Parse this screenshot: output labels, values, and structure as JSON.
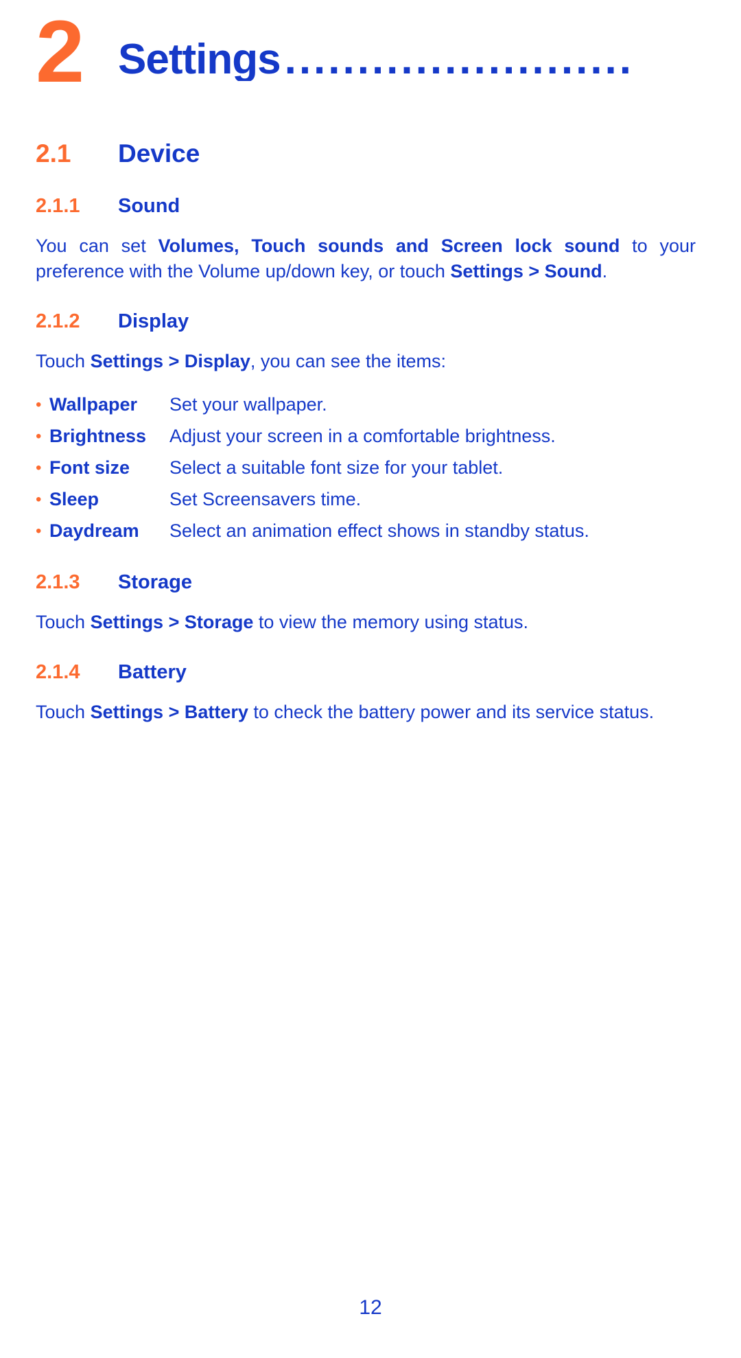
{
  "colors": {
    "accent_orange": "#fc6a2f",
    "accent_blue": "#1539c8",
    "background": "#ffffff"
  },
  "chapter": {
    "number": "2",
    "title": "Settings",
    "dots": "........................"
  },
  "sections": {
    "device": {
      "number": "2.1",
      "title": "Device"
    },
    "sound": {
      "number": "2.1.1",
      "title": "Sound",
      "paragraph": {
        "part1": "You can set ",
        "bold1": "Volumes, Touch sounds and Screen lock sound",
        "part2": " to your preference with the Volume up/down key, or touch ",
        "bold2": "Settings > Sound",
        "part3": "."
      }
    },
    "display": {
      "number": "2.1.2",
      "title": "Display",
      "intro": {
        "part1": "Touch ",
        "bold1": "Settings > Display",
        "part2": ", you can see the items:"
      },
      "items": [
        {
          "bullet": "•",
          "term": "Wallpaper",
          "desc": "Set your wallpaper."
        },
        {
          "bullet": "•",
          "term": "Brightness",
          "desc": "Adjust your screen in a comfortable brightness."
        },
        {
          "bullet": "•",
          "term": "Font size",
          "desc": "Select a suitable font size for your tablet."
        },
        {
          "bullet": "•",
          "term": "Sleep",
          "desc": "Set Screensavers time."
        },
        {
          "bullet": "•",
          "term": "Daydream",
          "desc": "Select an animation effect shows in standby status."
        }
      ]
    },
    "storage": {
      "number": "2.1.3",
      "title": "Storage",
      "paragraph": {
        "part1": "Touch ",
        "bold1": "Settings > Storage",
        "part2": " to view the memory using status."
      }
    },
    "battery": {
      "number": "2.1.4",
      "title": "Battery",
      "paragraph": {
        "part1": "Touch ",
        "bold1": "Settings > Battery",
        "part2": " to check the battery power and its service status."
      }
    }
  },
  "footer": {
    "page_number": "12"
  }
}
